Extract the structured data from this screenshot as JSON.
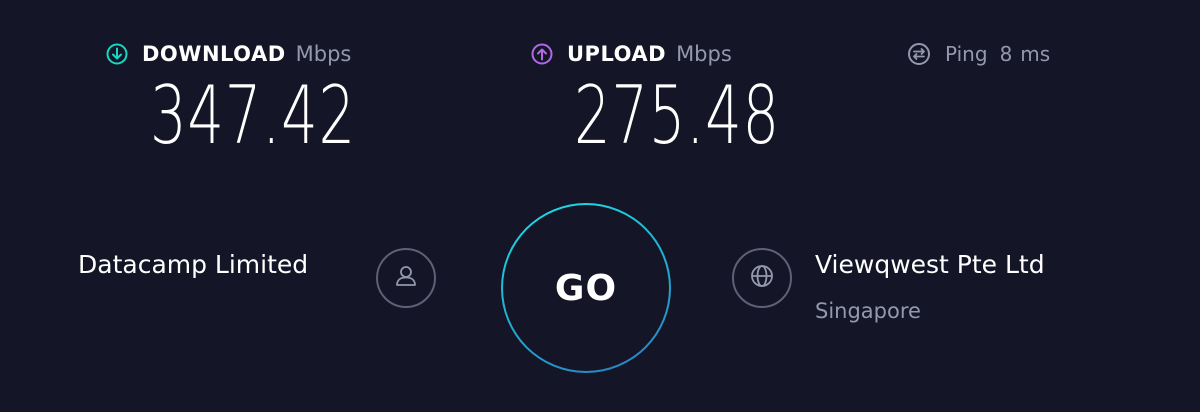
{
  "download": {
    "label": "DOWNLOAD",
    "unit": "Mbps",
    "value": "347.42",
    "icon": "download-arrow-icon",
    "color": "#16d7c4"
  },
  "upload": {
    "label": "UPLOAD",
    "unit": "Mbps",
    "value": "275.48",
    "icon": "upload-arrow-icon",
    "color": "#b06ae6"
  },
  "ping": {
    "label": "Ping",
    "value": "8",
    "unit": "ms",
    "icon": "ping-icon"
  },
  "go_button": {
    "label": "GO",
    "accent": "#1fd3e0"
  },
  "isp": {
    "name": "Datacamp Limited",
    "icon": "user-icon"
  },
  "server": {
    "name": "Viewqwest Pte Ltd",
    "location": "Singapore",
    "icon": "globe-icon"
  },
  "colors": {
    "background": "#141526",
    "muted": "#9597ad",
    "text": "#ffffff"
  }
}
